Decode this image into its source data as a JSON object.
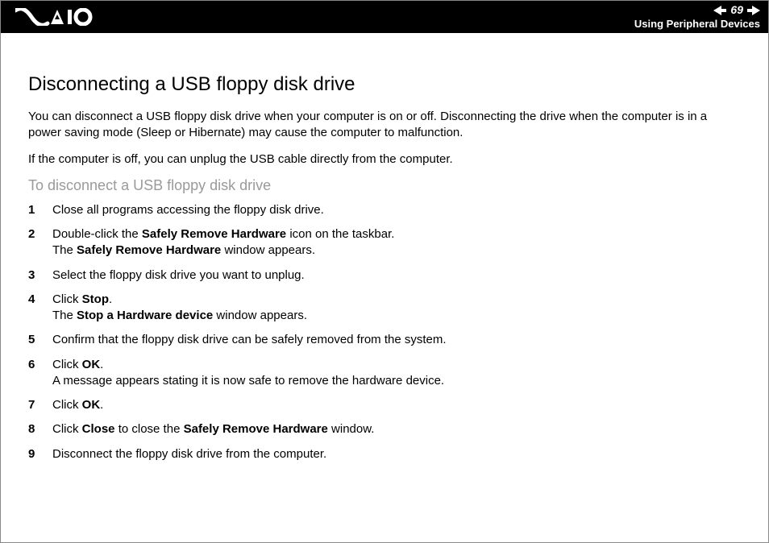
{
  "header": {
    "page_number": "69",
    "section": "Using Peripheral Devices"
  },
  "title": "Disconnecting a USB floppy disk drive",
  "paragraphs": [
    "You can disconnect a USB floppy disk drive when your computer is on or off. Disconnecting the drive when the computer is in a power saving mode (Sleep or Hibernate) may cause the computer to malfunction.",
    "If the computer is off, you can unplug the USB cable directly from the computer."
  ],
  "subheading": "To disconnect a USB floppy disk drive",
  "steps": [
    {
      "n": "1",
      "parts": [
        {
          "t": "Close all programs accessing the floppy disk drive."
        }
      ]
    },
    {
      "n": "2",
      "parts": [
        {
          "t": "Double-click the "
        },
        {
          "t": "Safely Remove Hardware",
          "b": true
        },
        {
          "t": " icon on the taskbar."
        },
        {
          "br": true
        },
        {
          "t": "The "
        },
        {
          "t": "Safely Remove Hardware",
          "b": true
        },
        {
          "t": " window appears."
        }
      ]
    },
    {
      "n": "3",
      "parts": [
        {
          "t": "Select the floppy disk drive you want to unplug."
        }
      ]
    },
    {
      "n": "4",
      "parts": [
        {
          "t": "Click "
        },
        {
          "t": "Stop",
          "b": true
        },
        {
          "t": "."
        },
        {
          "br": true
        },
        {
          "t": "The "
        },
        {
          "t": "Stop a Hardware device",
          "b": true
        },
        {
          "t": " window appears."
        }
      ]
    },
    {
      "n": "5",
      "parts": [
        {
          "t": "Confirm that the floppy disk drive can be safely removed from the system."
        }
      ]
    },
    {
      "n": "6",
      "parts": [
        {
          "t": "Click "
        },
        {
          "t": "OK",
          "b": true
        },
        {
          "t": "."
        },
        {
          "br": true
        },
        {
          "t": "A message appears stating it is now safe to remove the hardware device."
        }
      ]
    },
    {
      "n": "7",
      "parts": [
        {
          "t": "Click "
        },
        {
          "t": "OK",
          "b": true
        },
        {
          "t": "."
        }
      ]
    },
    {
      "n": "8",
      "parts": [
        {
          "t": "Click "
        },
        {
          "t": "Close",
          "b": true
        },
        {
          "t": " to close the "
        },
        {
          "t": "Safely Remove Hardware",
          "b": true
        },
        {
          "t": " window."
        }
      ]
    },
    {
      "n": "9",
      "parts": [
        {
          "t": "Disconnect the floppy disk drive from the computer."
        }
      ]
    }
  ]
}
